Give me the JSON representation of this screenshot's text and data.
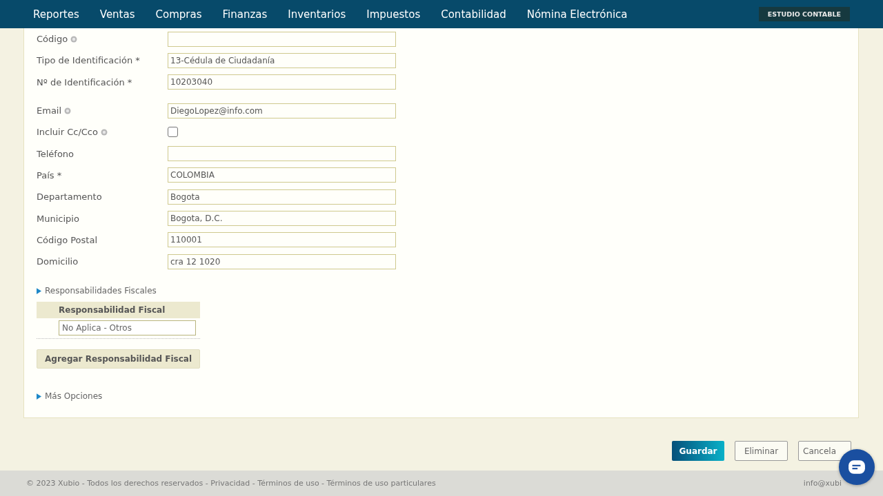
{
  "nav": {
    "items": [
      "Reportes",
      "Ventas",
      "Compras",
      "Finanzas",
      "Inventarios",
      "Impuestos",
      "Contabilidad",
      "Nómina Electrónica"
    ],
    "badge": "ESTUDIO CONTABLE"
  },
  "field_groups": [
    [
      {
        "kind": "input",
        "label": "Código",
        "help": true
      },
      {
        "kind": "input",
        "label": "Tipo de Identificación *",
        "help": false,
        "value": "13-Cédula de Ciudadanía"
      },
      {
        "kind": "input",
        "label": "Nº de Identificación *",
        "help": false,
        "value": "10203040"
      }
    ],
    [
      {
        "kind": "input",
        "label": "Email",
        "help": true,
        "value": "DiegoLopez@info.com"
      },
      {
        "kind": "checkbox",
        "label": "Incluir Cc/Cco",
        "help": true,
        "checked": false
      },
      {
        "kind": "input",
        "label": "Teléfono",
        "help": false
      },
      {
        "kind": "input",
        "label": "País *",
        "help": false,
        "value": "COLOMBIA"
      },
      {
        "kind": "input",
        "label": "Departamento",
        "help": false,
        "value": "Bogota"
      },
      {
        "kind": "input",
        "label": "Municipio",
        "help": false,
        "value": "Bogota, D.C."
      },
      {
        "kind": "input",
        "label": "Código Postal",
        "help": false,
        "value": "110001"
      },
      {
        "kind": "input",
        "label": "Domicilio",
        "help": false,
        "value": "cra 12 1020"
      }
    ]
  ],
  "fiscal": {
    "title": "Responsabilidades Fiscales",
    "expanded": false,
    "column": "Responsabilidad Fiscal",
    "rows": [
      "No Aplica - Otros"
    ],
    "add_button": "Agregar Responsabilidad Fiscal"
  },
  "more_options": {
    "title": "Más Opciones",
    "expanded": false
  },
  "actions": [
    {
      "label": "Guardar",
      "kind": "primary"
    },
    {
      "label": "Eliminar",
      "kind": "secondary"
    },
    {
      "label": "Cancela",
      "kind": "secondary"
    }
  ],
  "footer": {
    "text": "© 2023 Xubio - Todos los derechos reservados - Privacidad - Términos de uso - Términos de uso particulares",
    "email": "info@xubi"
  }
}
